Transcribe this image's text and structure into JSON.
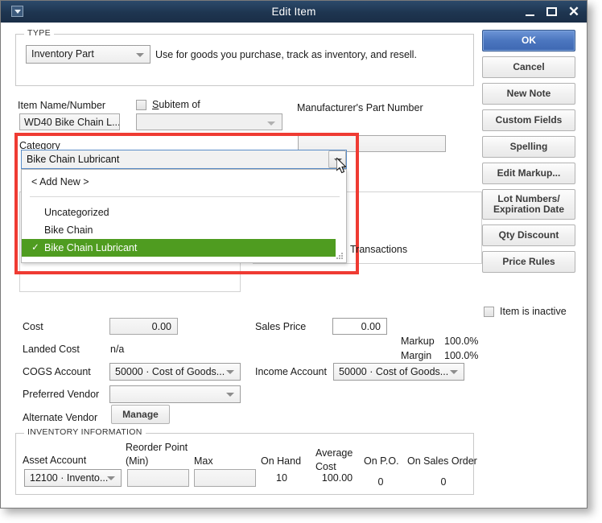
{
  "window": {
    "title": "Edit Item",
    "sysmenu_icon": "window-menu-icon",
    "minimize_icon": "minimize-icon",
    "maximize_icon": "maximize-icon",
    "close_icon": "close-icon",
    "close_glyph": "✕"
  },
  "type_section": {
    "legend": "TYPE",
    "selected": "Inventory Part",
    "description": "Use for goods you purchase, track as inventory, and resell."
  },
  "identity": {
    "item_name_label": "Item Name/Number",
    "item_name_value": "WD40 Bike Chain L...",
    "subitem_label_prefix": "S",
    "subitem_label_rest": "ubitem of",
    "subitem_checked": false,
    "subitem_value": "",
    "mpn_label": "Manufacturer's Part Number",
    "mpn_value": ""
  },
  "category": {
    "label": "Category",
    "value": "Bike Chain Lubricant",
    "dropdown_open": true,
    "add_new": "< Add New >",
    "options": [
      {
        "label": "Uncategorized",
        "selected": false
      },
      {
        "label": "Bike Chain",
        "selected": false
      },
      {
        "label": "Bike Chain Lubricant",
        "selected": true
      }
    ],
    "check_glyph": "✓",
    "highlight_color": "#4f9c20",
    "resize_grip_icon": "resize-grip-icon"
  },
  "annotation": {
    "highlight_color": "#ef3b33"
  },
  "purchase": {
    "cost_label": "Cost",
    "cost_value": "0.00",
    "landed_cost_label": "Landed Cost",
    "landed_cost_value": "n/a",
    "cogs_label": "COGS Account",
    "cogs_value": "50000 · Cost of Goods...",
    "preferred_vendor_label": "Preferred Vendor",
    "preferred_vendor_value": "",
    "alternate_vendor_label": "Alternate Vendor",
    "manage_button": "Manage"
  },
  "sales": {
    "transactions_label": "Transactions",
    "sales_price_label": "Sales Price",
    "sales_price_value": "0.00",
    "markup_label": "Markup",
    "markup_value": "100.0%",
    "margin_label": "Margin",
    "margin_value": "100.0%",
    "income_account_label": "Income Account",
    "income_account_value": "50000 · Cost of Goods..."
  },
  "buttons": {
    "ok": "OK",
    "cancel": "Cancel",
    "new_note": "New Note",
    "custom_fields": "Custom Fields",
    "spelling": "Spelling",
    "edit_markup": "Edit Markup...",
    "lot_numbers": "Lot Numbers/\nExpiration Date",
    "qty_discount": "Qty Discount",
    "price_rules": "Price Rules",
    "item_inactive": "Item is inactive",
    "item_inactive_checked": false,
    "ok_color": "#4b76bf"
  },
  "inventory": {
    "legend": "INVENTORY INFORMATION",
    "asset_account_label": "Asset Account",
    "asset_account_value": "12100 · Invento...",
    "reorder_point_label": "Reorder Point",
    "reorder_point_sub": "(Min)",
    "reorder_point_value": "",
    "max_label": "Max",
    "max_value": "",
    "on_hand_label": "On Hand",
    "on_hand_value": "10",
    "average_cost_label": "Average",
    "average_cost_sub": "Cost",
    "average_cost_value": "100.00",
    "on_po_label": "On P.O.",
    "on_po_value": "0",
    "on_sales_order_label": "On Sales Order",
    "on_sales_order_value": "0"
  }
}
